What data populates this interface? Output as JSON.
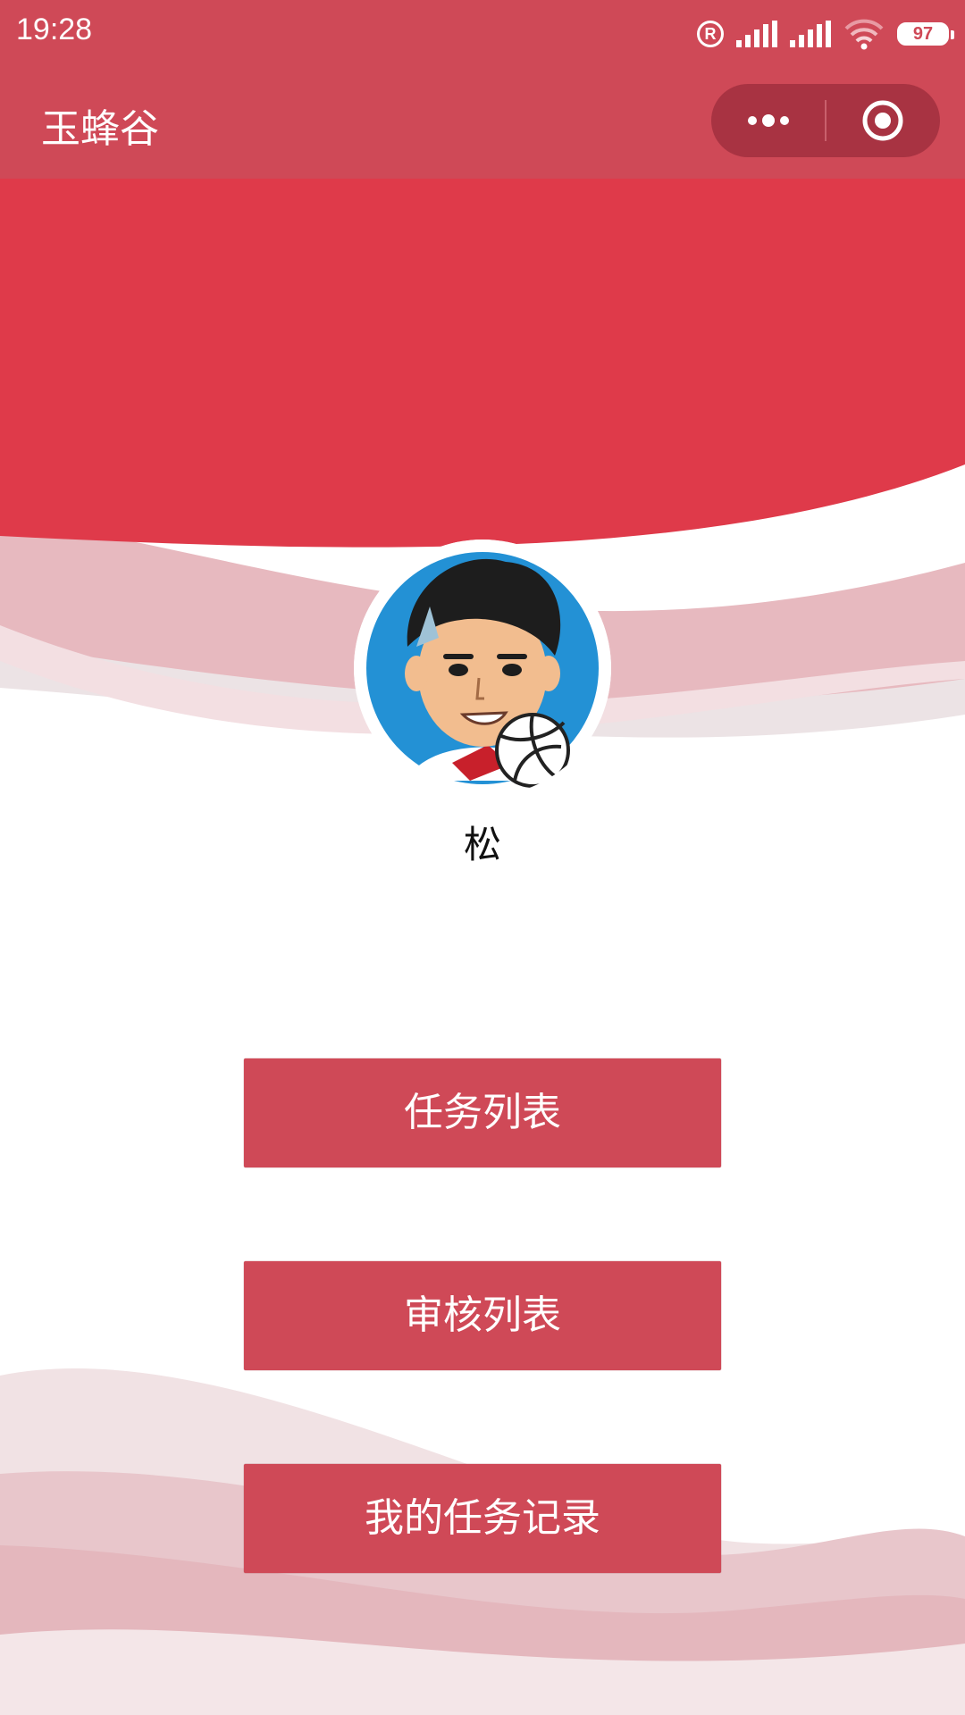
{
  "status_bar": {
    "time": "19:28",
    "registered_mark": "R",
    "battery": "97",
    "icons": [
      "registered-icon",
      "signal-icon",
      "signal-icon",
      "wifi-icon",
      "battery-icon"
    ]
  },
  "nav": {
    "title": "玉蜂谷",
    "icons": [
      "more-icon",
      "close-target-icon"
    ]
  },
  "profile": {
    "name": "松"
  },
  "menu": {
    "task_list": "任务列表",
    "review_list": "审核列表",
    "my_task_records": "我的任务记录"
  },
  "colors": {
    "primary": "#cf4957",
    "hero_red": "#df3a4a",
    "capsule": "#a83342",
    "wave_light": "#e9b3ba"
  }
}
